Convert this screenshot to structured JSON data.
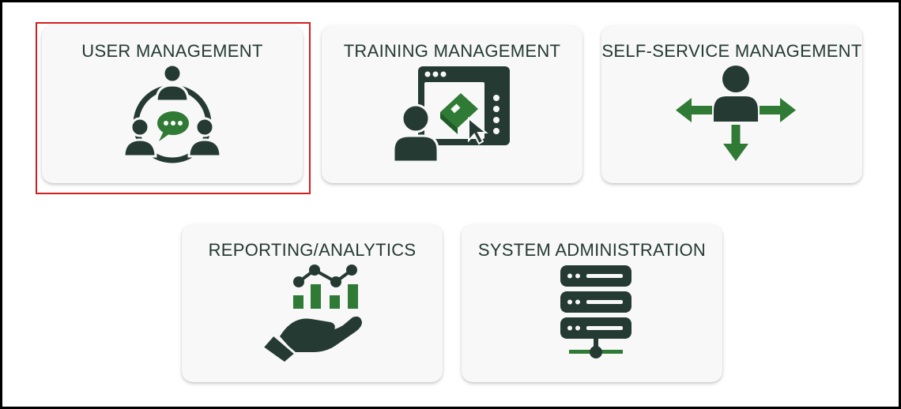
{
  "colors": {
    "dark": "#243a33",
    "green": "#2f7a34",
    "card_bg": "#f8f8f8",
    "selection_border": "#d11f1f"
  },
  "cards": [
    {
      "label": "USER MANAGEMENT",
      "icon": "users-chat-icon",
      "selected": true
    },
    {
      "label": "TRAINING MANAGEMENT",
      "icon": "online-training-icon",
      "selected": false
    },
    {
      "label": "SELF-SERVICE MANAGEMENT",
      "icon": "user-arrows-icon",
      "selected": false
    },
    {
      "label": "REPORTING/ANALYTICS",
      "icon": "hand-chart-icon",
      "selected": false
    },
    {
      "label": "SYSTEM ADMINISTRATION",
      "icon": "server-icon",
      "selected": false
    }
  ]
}
